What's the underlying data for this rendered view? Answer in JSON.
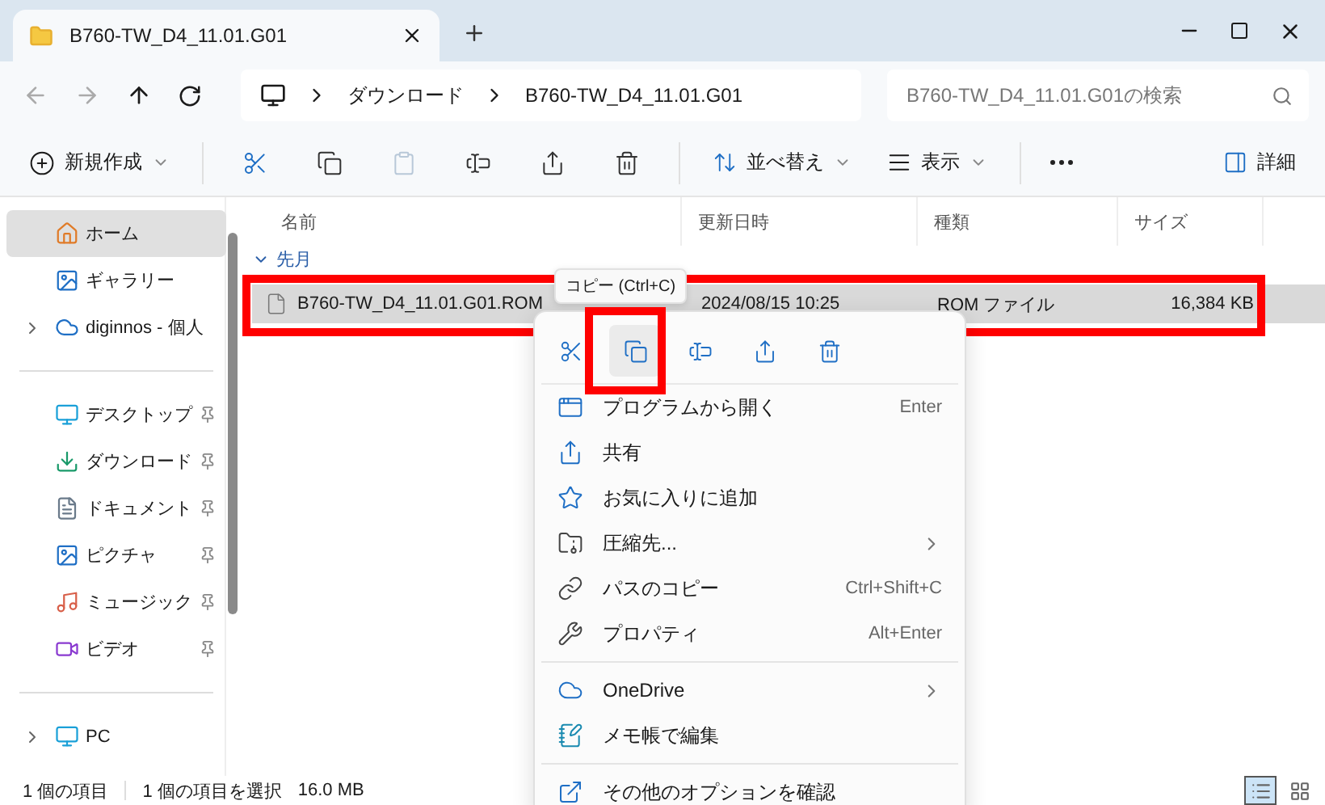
{
  "window": {
    "tab_title": "B760-TW_D4_11.01.G01"
  },
  "address": {
    "segments": [
      "ダウンロード",
      "B760-TW_D4_11.01.G01"
    ]
  },
  "search": {
    "placeholder": "B760-TW_D4_11.01.G01の検索"
  },
  "toolbar": {
    "new_label": "新規作成",
    "actions": [
      {
        "kind": "cut",
        "disabled": false
      },
      {
        "kind": "copy",
        "disabled": false
      },
      {
        "kind": "paste",
        "disabled": true
      },
      {
        "kind": "rename",
        "disabled": false
      },
      {
        "kind": "share",
        "disabled": false
      },
      {
        "kind": "delete",
        "disabled": false
      }
    ],
    "sort_label": "並べ替え",
    "view_label": "表示",
    "details_label": "詳細"
  },
  "sidebar": {
    "groups": [
      [
        {
          "kind": "home",
          "label": "ホーム",
          "selected": true,
          "pinned": false,
          "expandable": false
        },
        {
          "kind": "gallery",
          "label": "ギャラリー",
          "selected": false,
          "pinned": false,
          "expandable": false
        },
        {
          "kind": "cloud",
          "label": "diginnos - 個人",
          "selected": false,
          "pinned": false,
          "expandable": true
        }
      ],
      [
        {
          "kind": "desktop",
          "label": "デスクトップ",
          "selected": false,
          "pinned": true,
          "expandable": false
        },
        {
          "kind": "download",
          "label": "ダウンロード",
          "selected": false,
          "pinned": true,
          "expandable": false
        },
        {
          "kind": "documents",
          "label": "ドキュメント",
          "selected": false,
          "pinned": true,
          "expandable": false
        },
        {
          "kind": "pictures",
          "label": "ピクチャ",
          "selected": false,
          "pinned": true,
          "expandable": false
        },
        {
          "kind": "music",
          "label": "ミュージック",
          "selected": false,
          "pinned": true,
          "expandable": false
        },
        {
          "kind": "videos",
          "label": "ビデオ",
          "selected": false,
          "pinned": true,
          "expandable": false
        }
      ],
      [
        {
          "kind": "pc",
          "label": "PC",
          "selected": false,
          "pinned": false,
          "expandable": true
        }
      ]
    ]
  },
  "table": {
    "columns": [
      "名前",
      "更新日時",
      "種類",
      "サイズ"
    ],
    "groups": [
      {
        "label": "先月",
        "expanded": true,
        "rows": [
          {
            "name": "B760-TW_D4_11.01.G01.ROM",
            "modified": "2024/08/15 10:25",
            "type": "ROM ファイル",
            "size": "16,384 KB",
            "selected": true
          }
        ]
      }
    ]
  },
  "context_menu": {
    "tooltip": "コピー (Ctrl+C)",
    "actions": [
      {
        "kind": "cut",
        "selected": false
      },
      {
        "kind": "copy",
        "selected": true
      },
      {
        "kind": "rename",
        "selected": false
      },
      {
        "kind": "share",
        "selected": false
      },
      {
        "kind": "delete",
        "selected": false
      }
    ],
    "sections": [
      [
        {
          "kind": "open",
          "label": "プログラムから開く",
          "shortcut": "Enter",
          "submenu": false
        },
        {
          "kind": "share",
          "label": "共有",
          "submenu": false
        },
        {
          "kind": "favorite",
          "label": "お気に入りに追加",
          "submenu": false
        },
        {
          "kind": "zip",
          "label": "圧縮先...",
          "submenu": true
        },
        {
          "kind": "path",
          "label": "パスのコピー",
          "shortcut": "Ctrl+Shift+C",
          "submenu": false
        },
        {
          "kind": "properties",
          "label": "プロパティ",
          "shortcut": "Alt+Enter",
          "submenu": false
        }
      ],
      [
        {
          "kind": "cloud",
          "label": "OneDrive",
          "submenu": true
        },
        {
          "kind": "notepad",
          "label": "メモ帳で編集",
          "submenu": false
        }
      ],
      [
        {
          "kind": "more",
          "label": "その他のオプションを確認",
          "submenu": false
        }
      ]
    ]
  },
  "status_bar": {
    "count": "1 個の項目",
    "selection": "1 個の項目を選択",
    "size": "16.0 MB",
    "view_modes": [
      {
        "kind": "details",
        "selected": true
      },
      {
        "kind": "tiles",
        "selected": false
      }
    ]
  }
}
